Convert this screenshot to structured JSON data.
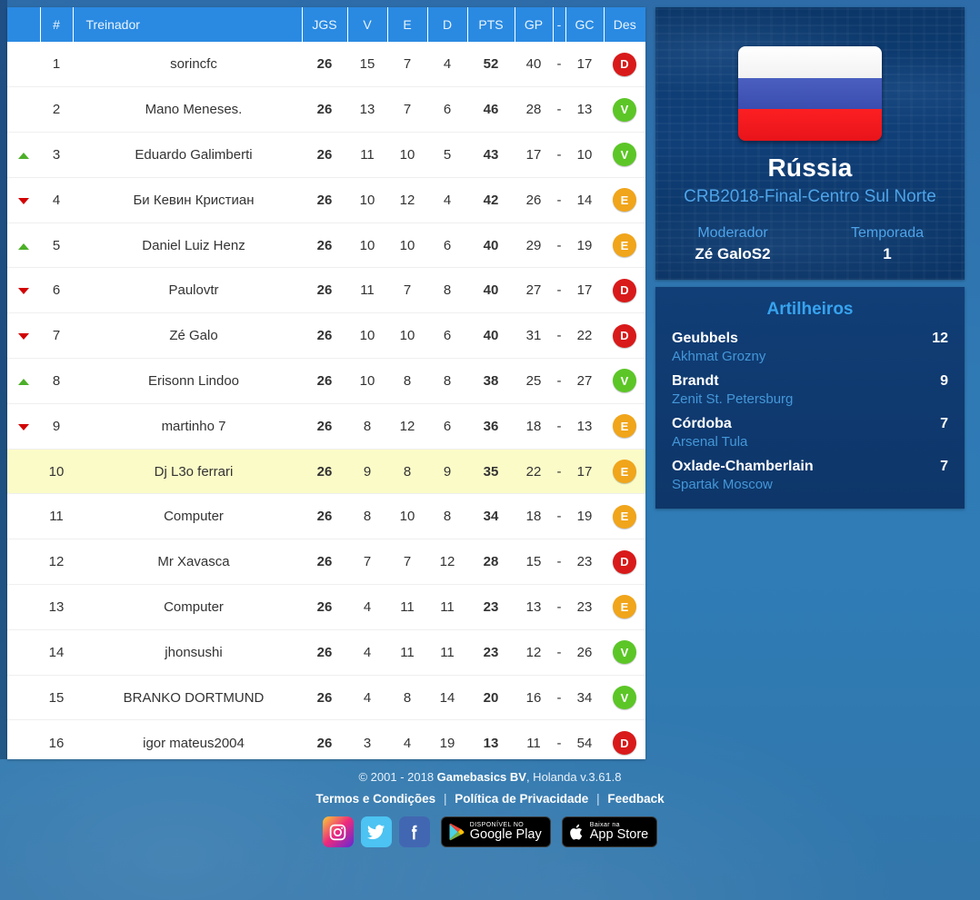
{
  "table": {
    "headers": {
      "arrow": "",
      "rank": "#",
      "name": "Treinador",
      "jgs": "JGS",
      "v": "V",
      "e": "E",
      "d": "D",
      "pts": "PTS",
      "gp": "GP",
      "dash": "-",
      "gc": "GC",
      "des": "Des"
    },
    "rows": [
      {
        "trend": "none",
        "rank": "1",
        "name": "sorincfc",
        "jgs": "26",
        "v": "15",
        "e": "7",
        "d": "4",
        "pts": "52",
        "gp": "40",
        "gc": "17",
        "des": "D",
        "highlight": false
      },
      {
        "trend": "none",
        "rank": "2",
        "name": "Mano Meneses.",
        "jgs": "26",
        "v": "13",
        "e": "7",
        "d": "6",
        "pts": "46",
        "gp": "28",
        "gc": "13",
        "des": "V",
        "highlight": false
      },
      {
        "trend": "up",
        "rank": "3",
        "name": "Eduardo Galimberti",
        "jgs": "26",
        "v": "11",
        "e": "10",
        "d": "5",
        "pts": "43",
        "gp": "17",
        "gc": "10",
        "des": "V",
        "highlight": false
      },
      {
        "trend": "down",
        "rank": "4",
        "name": "Би Кевин Кристиан",
        "jgs": "26",
        "v": "10",
        "e": "12",
        "d": "4",
        "pts": "42",
        "gp": "26",
        "gc": "14",
        "des": "E",
        "highlight": false
      },
      {
        "trend": "up",
        "rank": "5",
        "name": "Daniel Luiz Henz",
        "jgs": "26",
        "v": "10",
        "e": "10",
        "d": "6",
        "pts": "40",
        "gp": "29",
        "gc": "19",
        "des": "E",
        "highlight": false
      },
      {
        "trend": "down",
        "rank": "6",
        "name": "Paulovtr",
        "jgs": "26",
        "v": "11",
        "e": "7",
        "d": "8",
        "pts": "40",
        "gp": "27",
        "gc": "17",
        "des": "D",
        "highlight": false
      },
      {
        "trend": "down",
        "rank": "7",
        "name": "Zé Galo",
        "jgs": "26",
        "v": "10",
        "e": "10",
        "d": "6",
        "pts": "40",
        "gp": "31",
        "gc": "22",
        "des": "D",
        "highlight": false
      },
      {
        "trend": "up",
        "rank": "8",
        "name": "Erisonn Lindoo",
        "jgs": "26",
        "v": "10",
        "e": "8",
        "d": "8",
        "pts": "38",
        "gp": "25",
        "gc": "27",
        "des": "V",
        "highlight": false
      },
      {
        "trend": "down",
        "rank": "9",
        "name": "martinho 7",
        "jgs": "26",
        "v": "8",
        "e": "12",
        "d": "6",
        "pts": "36",
        "gp": "18",
        "gc": "13",
        "des": "E",
        "highlight": false
      },
      {
        "trend": "none",
        "rank": "10",
        "name": "Dj L3o ferrari",
        "jgs": "26",
        "v": "9",
        "e": "8",
        "d": "9",
        "pts": "35",
        "gp": "22",
        "gc": "17",
        "des": "E",
        "highlight": true
      },
      {
        "trend": "none",
        "rank": "11",
        "name": "Computer",
        "jgs": "26",
        "v": "8",
        "e": "10",
        "d": "8",
        "pts": "34",
        "gp": "18",
        "gc": "19",
        "des": "E",
        "highlight": false
      },
      {
        "trend": "none",
        "rank": "12",
        "name": "Mr Xavasca",
        "jgs": "26",
        "v": "7",
        "e": "7",
        "d": "12",
        "pts": "28",
        "gp": "15",
        "gc": "23",
        "des": "D",
        "highlight": false
      },
      {
        "trend": "none",
        "rank": "13",
        "name": "Computer",
        "jgs": "26",
        "v": "4",
        "e": "11",
        "d": "11",
        "pts": "23",
        "gp": "13",
        "gc": "23",
        "des": "E",
        "highlight": false
      },
      {
        "trend": "none",
        "rank": "14",
        "name": "jhonsushi",
        "jgs": "26",
        "v": "4",
        "e": "11",
        "d": "11",
        "pts": "23",
        "gp": "12",
        "gc": "26",
        "des": "V",
        "highlight": false
      },
      {
        "trend": "none",
        "rank": "15",
        "name": "BRANKO DORTMUND",
        "jgs": "26",
        "v": "4",
        "e": "8",
        "d": "14",
        "pts": "20",
        "gp": "16",
        "gc": "34",
        "des": "V",
        "highlight": false
      },
      {
        "trend": "none",
        "rank": "16",
        "name": "igor mateus2004",
        "jgs": "26",
        "v": "3",
        "e": "4",
        "d": "19",
        "pts": "13",
        "gp": "11",
        "gc": "54",
        "des": "D",
        "highlight": false
      }
    ],
    "dash": "-"
  },
  "club_panel": {
    "flag_icon": "russia-flag-icon",
    "club_name": "Rússia",
    "league_name": "CRB2018-Final-Centro Sul Norte",
    "moderator_label": "Moderador",
    "moderator_value": "Zé GaloS2",
    "season_label": "Temporada",
    "season_value": "1"
  },
  "scorers": {
    "title": "Artilheiros",
    "items": [
      {
        "name": "Geubbels",
        "team": "Akhmat Grozny",
        "goals": "12"
      },
      {
        "name": "Brandt",
        "team": "Zenit St. Petersburg",
        "goals": "9"
      },
      {
        "name": "Córdoba",
        "team": "Arsenal Tula",
        "goals": "7"
      },
      {
        "name": "Oxlade-Chamberlain",
        "team": "Spartak Moscow",
        "goals": "7"
      }
    ]
  },
  "footer": {
    "copyright_pre": "© 2001 - 2018 ",
    "copyright_brand": "Gamebasics BV",
    "copyright_post": ", Holanda v.3.61.8",
    "links": [
      {
        "label": "Termos e Condições"
      },
      {
        "label": "Política de Privacidade"
      },
      {
        "label": "Feedback"
      }
    ],
    "separator": "|",
    "social": [
      {
        "icon": "instagram-icon"
      },
      {
        "icon": "twitter-icon"
      },
      {
        "icon": "facebook-icon"
      }
    ],
    "google_play": {
      "small": "DISPONÍVEL NO",
      "big": "Google Play"
    },
    "app_store": {
      "small": "Baixar na",
      "big": "App Store"
    }
  },
  "colors": {
    "header_blue": "#2a8ae2",
    "badge_win": "#5cc627",
    "badge_loss": "#d91a1a",
    "badge_draw": "#f0a51b",
    "highlight_row": "#fbfbc8",
    "panel_accent": "#4ea4e8"
  }
}
